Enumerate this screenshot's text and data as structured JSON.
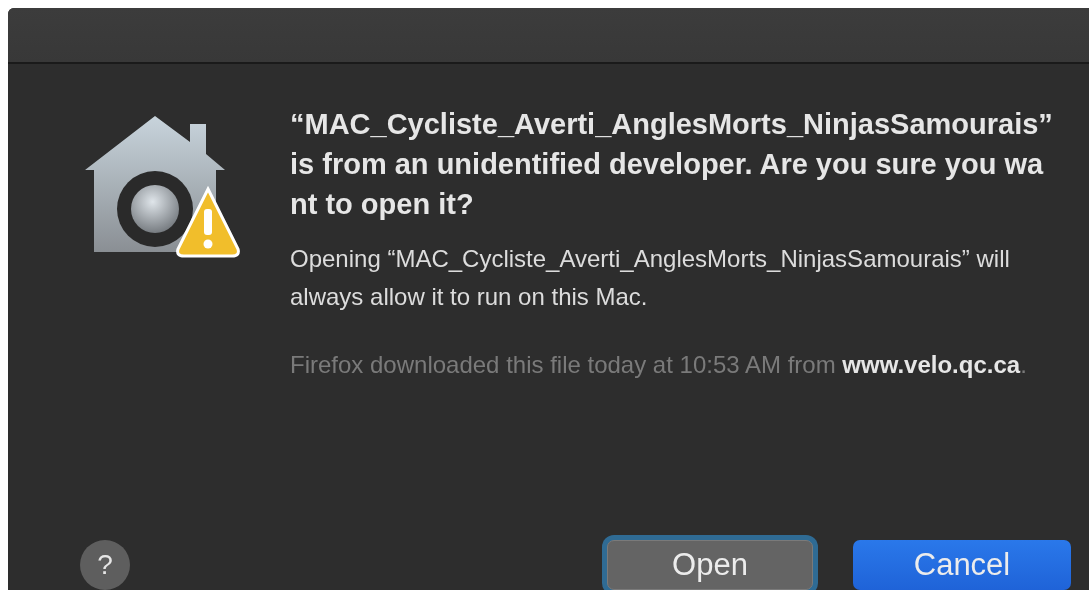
{
  "dialog": {
    "title": "“MAC_Cycliste_Averti_AnglesMorts_NinjasSamourais” is from an unidentified developer. Are you sure you want to open it?",
    "message": "Opening “MAC_Cycliste_Averti_AnglesMorts_NinjasSamourais” will always allow it to run on this Mac.",
    "source_text": "Firefox downloaded this file today at 10:53 AM from",
    "source_link": "www.velo.qc.ca",
    "source_end": ".",
    "help": "?",
    "buttons": [
      {
        "label": "Open",
        "primary": false,
        "focused": true
      },
      {
        "label": "Cancel",
        "primary": true,
        "focused": false
      }
    ]
  }
}
